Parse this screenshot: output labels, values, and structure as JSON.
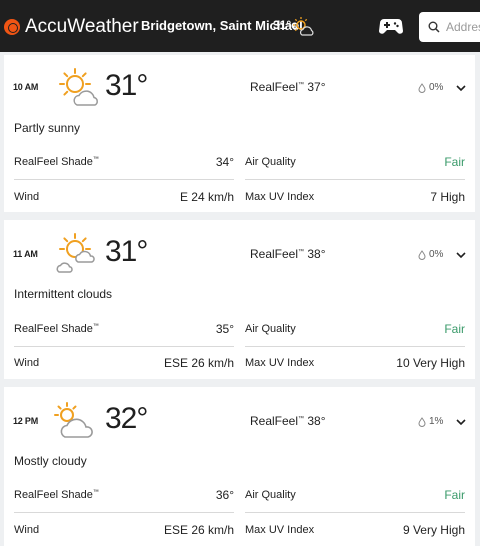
{
  "header": {
    "brand": "AccuWeather",
    "location": "Bridgetown, Saint Michael",
    "current_temp": "31°c",
    "search_placeholder": "Address"
  },
  "hours": [
    {
      "time": "10 AM",
      "icon": "partly-sunny-icon",
      "temp": "31°",
      "realfeel_label": "RealFeel",
      "realfeel_value": "37°",
      "precip": "0%",
      "phrase": "Partly sunny",
      "shade_label": "RealFeel Shade",
      "shade_value": "34°",
      "aq_label": "Air Quality",
      "aq_value": "Fair",
      "wind_label": "Wind",
      "wind_value": "E 24 km/h",
      "uv_label": "Max UV Index",
      "uv_value": "7 High"
    },
    {
      "time": "11 AM",
      "icon": "intermittent-clouds-icon",
      "temp": "31°",
      "realfeel_label": "RealFeel",
      "realfeel_value": "38°",
      "precip": "0%",
      "phrase": "Intermittent clouds",
      "shade_label": "RealFeel Shade",
      "shade_value": "35°",
      "aq_label": "Air Quality",
      "aq_value": "Fair",
      "wind_label": "Wind",
      "wind_value": "ESE 26 km/h",
      "uv_label": "Max UV Index",
      "uv_value": "10 Very High"
    },
    {
      "time": "12 PM",
      "icon": "mostly-cloudy-icon",
      "temp": "32°",
      "realfeel_label": "RealFeel",
      "realfeel_value": "38°",
      "precip": "1%",
      "phrase": "Mostly cloudy",
      "shade_label": "RealFeel Shade",
      "shade_value": "36°",
      "aq_label": "Air Quality",
      "aq_value": "Fair",
      "wind_label": "Wind",
      "wind_value": "ESE 26 km/h",
      "uv_label": "Max UV Index",
      "uv_value": "9 Very High"
    }
  ],
  "colors": {
    "header_bg": "#1f1f1f",
    "brand_orange": "#f05514",
    "fair_green": "#3a9a6a"
  }
}
